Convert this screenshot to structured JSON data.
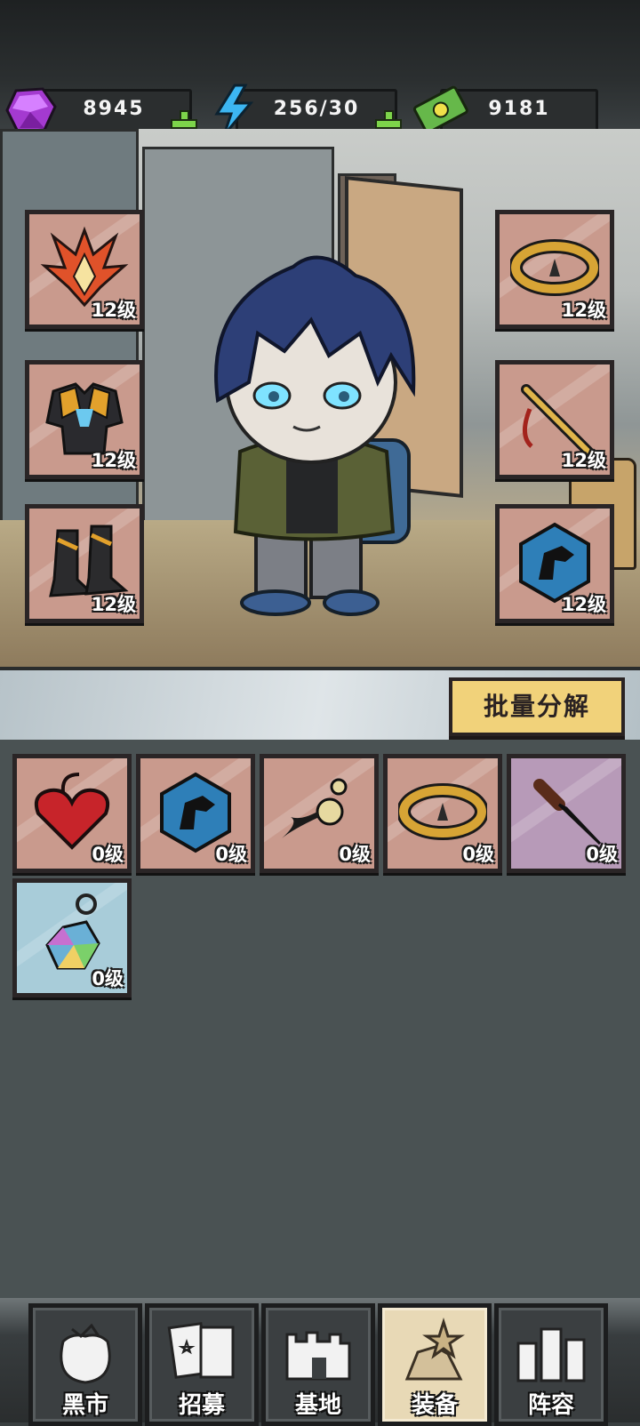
{
  "resources": {
    "gems": "8945",
    "energy": "256/30",
    "cash": "9181"
  },
  "equipped": {
    "left": [
      {
        "icon": "flame-helmet-icon",
        "level": "12级"
      },
      {
        "icon": "armor-chest-icon",
        "level": "12级"
      },
      {
        "icon": "boots-icon",
        "level": "12级"
      }
    ],
    "right": [
      {
        "icon": "gold-bracelet-icon",
        "level": "12级"
      },
      {
        "icon": "golden-dagger-icon",
        "level": "12级"
      },
      {
        "icon": "dino-badge-icon",
        "level": "12级"
      }
    ]
  },
  "batch_label": "批量分解",
  "inventory": [
    {
      "icon": "heart-bag-icon",
      "level": "0级",
      "rarity": "red"
    },
    {
      "icon": "dino-badge-icon",
      "level": "0级",
      "rarity": "red"
    },
    {
      "icon": "tassel-charm-icon",
      "level": "0级",
      "rarity": "red"
    },
    {
      "icon": "gold-bracelet-icon",
      "level": "0级",
      "rarity": "red"
    },
    {
      "icon": "knife-icon",
      "level": "0级",
      "rarity": "purple"
    },
    {
      "icon": "crystal-keychain-icon",
      "level": "0级",
      "rarity": "blue"
    }
  ],
  "nav": [
    {
      "label": "黑市",
      "icon": "sack-icon",
      "active": false
    },
    {
      "label": "招募",
      "icon": "cards-icon",
      "active": false
    },
    {
      "label": "基地",
      "icon": "fort-icon",
      "active": false
    },
    {
      "label": "装备",
      "icon": "gear-pile-icon",
      "active": true
    },
    {
      "label": "阵容",
      "icon": "squad-icon",
      "active": false
    }
  ]
}
